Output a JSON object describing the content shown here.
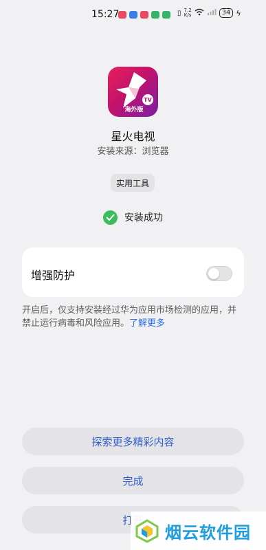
{
  "status_bar": {
    "time": "15:27",
    "net_speed_top": "7.2",
    "net_speed_bottom": "K/s",
    "battery": "34"
  },
  "app": {
    "name": "星火电视",
    "source": "安装来源：浏览器",
    "icon_badge_text": "海外版",
    "icon_tv_text": "TV"
  },
  "category_tag": "实用工具",
  "install_status": "安装成功",
  "protection": {
    "label": "增强防护",
    "enabled": false,
    "description": "开启后，仅支持安装经过华为应用市场检测的应用，并禁止运行病毒和风险应用。",
    "learn_more": "了解更多"
  },
  "buttons": {
    "explore": "探索更多精彩内容",
    "done": "完成",
    "open": "打开"
  },
  "watermark": "烟云软件园",
  "colors": {
    "accent": "#2f5fc6",
    "success": "#3ebb5b",
    "link": "#2a6ff0",
    "background": "#f1f1f3"
  }
}
